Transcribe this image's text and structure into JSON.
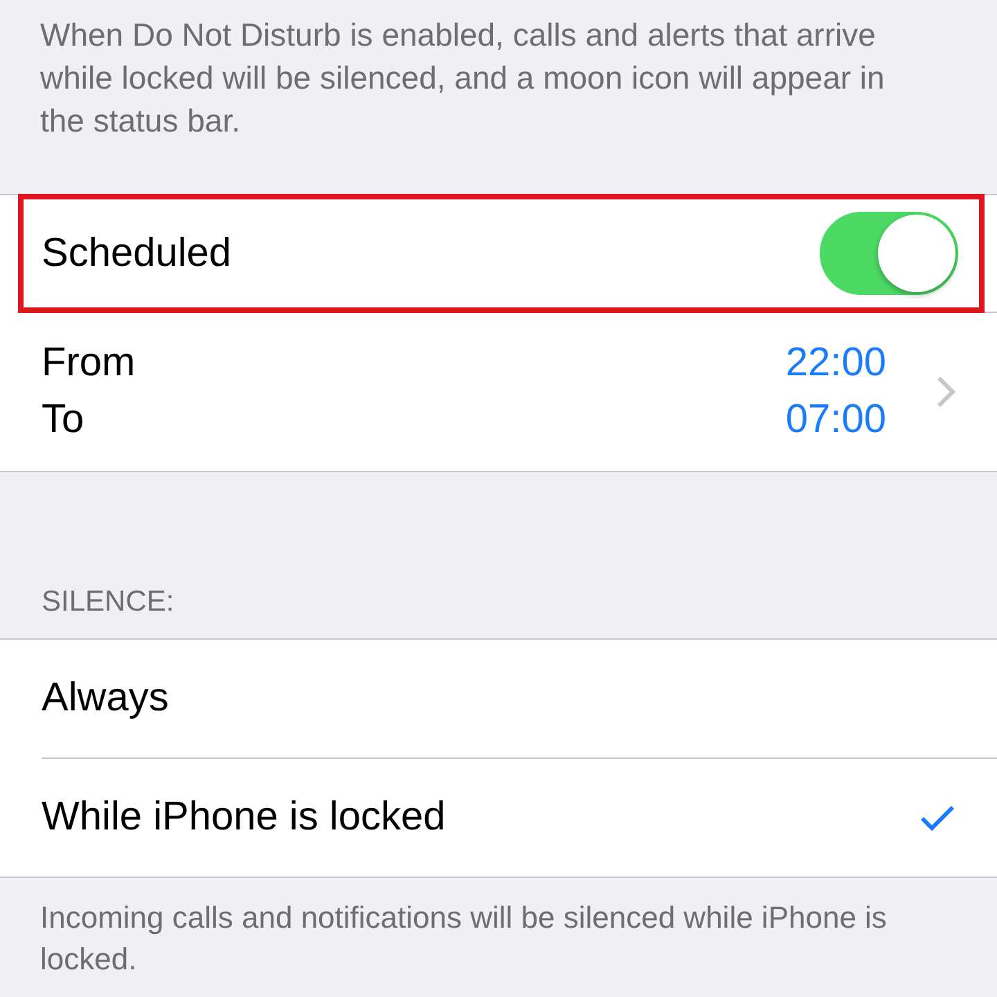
{
  "intro_text": "When Do Not Disturb is enabled, calls and alerts that arrive while locked will be silenced, and a moon icon will appear in the status bar.",
  "scheduled": {
    "label": "Scheduled",
    "on": true,
    "highlighted": true
  },
  "schedule": {
    "from_label": "From",
    "from_time": "22:00",
    "to_label": "To",
    "to_time": "07:00"
  },
  "silence": {
    "header": "SILENCE:",
    "options": [
      {
        "label": "Always",
        "selected": false
      },
      {
        "label": "While iPhone is locked",
        "selected": true
      }
    ],
    "footer": "Incoming calls and notifications will be silenced while iPhone is locked."
  }
}
